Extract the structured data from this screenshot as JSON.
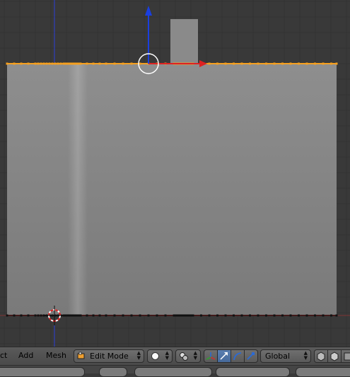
{
  "header": {
    "menu": {
      "select": "ct",
      "add": "Add",
      "mesh": "Mesh"
    },
    "mode": "Edit Mode",
    "orientation": "Global"
  },
  "colors": {
    "viewport_bg": "#393939",
    "selection": "#f5a020",
    "x_axis": "#dd2222",
    "z_axis": "#1a3fe0",
    "active_blue": "#5b7fb0"
  }
}
